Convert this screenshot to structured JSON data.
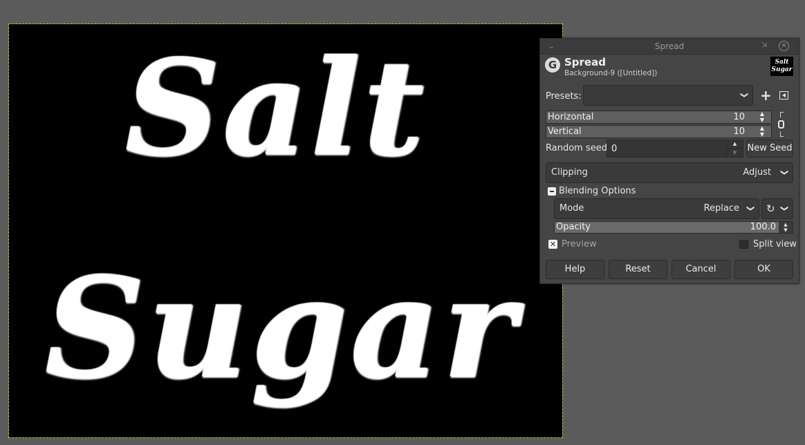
{
  "canvas": {
    "line1": "Salt",
    "line2": "Sugar"
  },
  "dialog": {
    "window_title": "Spread",
    "title": "Spread",
    "subtitle": "Background-9 ([Untitled])",
    "thumbnail": {
      "line1": "Salt",
      "line2": "Sugar"
    },
    "presets": {
      "label": "Presets:",
      "value": ""
    },
    "horizontal": {
      "label": "Horizontal",
      "value": "10",
      "fill_fraction": 0.0
    },
    "vertical": {
      "label": "Vertical",
      "value": "10",
      "fill_fraction": 0.0
    },
    "random_seed": {
      "label": "Random seed",
      "value": "0",
      "new_seed_label": "New Seed"
    },
    "clipping": {
      "label": "Clipping",
      "value": "Adjust"
    },
    "blending": {
      "header": "Blending Options",
      "mode_label": "Mode",
      "mode_value": "Replace",
      "opacity_label": "Opacity",
      "opacity_value": "100.0",
      "opacity_fraction": 1.0
    },
    "preview": {
      "label": "Preview",
      "checked": true
    },
    "split_view": {
      "label": "Split view",
      "checked": false
    },
    "buttons": {
      "help": "Help",
      "reset": "Reset",
      "cancel": "Cancel",
      "ok": "OK"
    }
  },
  "colors": {
    "workspace": "#5b5b5b",
    "dialog_bg": "#454545",
    "canvas_bg": "#000000",
    "selection_outline": "#c9c900"
  },
  "icons": [
    "gimp-logo-icon",
    "plus-icon",
    "panel-icon",
    "chain-link-icon",
    "reset-mode-icon",
    "chevron-down-icon",
    "close-icon"
  ]
}
